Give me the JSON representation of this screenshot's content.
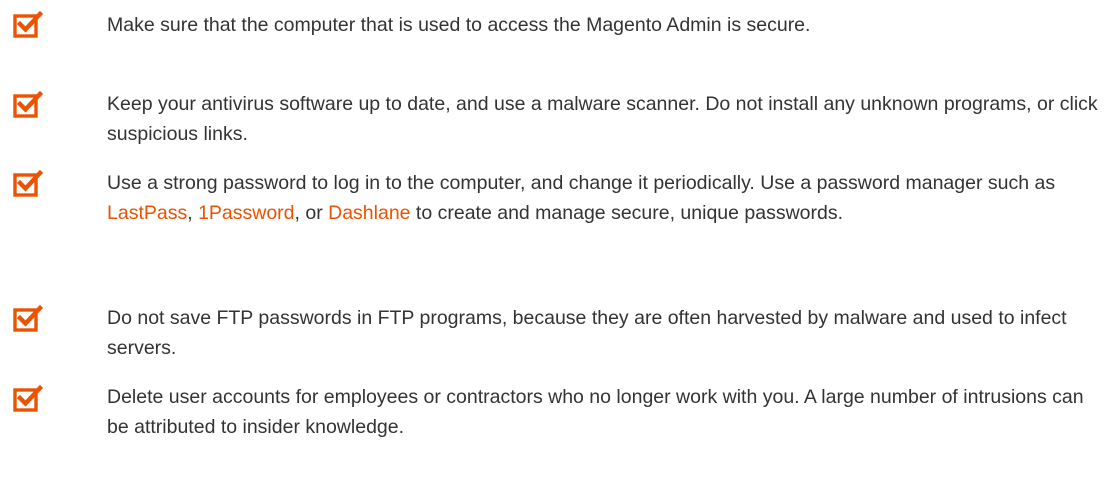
{
  "accent_color": "#eb5202",
  "icon_name": "checkbox-checked-icon",
  "items": [
    {
      "text": "Make sure that the computer that is used to access the Magento Admin is secure."
    },
    {
      "text": "Keep your antivirus software up to date, and use a malware scanner. Do not install any unknown programs, or click suspicious links."
    },
    {
      "text_1": "Use a strong password to log in to the computer, and change it periodically. Use a password manager such as ",
      "link_1": "LastPass",
      "sep_1": ", ",
      "link_2": "1Password",
      "sep_2": ", or ",
      "link_3": "Dashlane",
      "text_2": " to create and manage secure, unique passwords."
    },
    {
      "text": "Do not save FTP passwords in FTP programs, because they are often harvested by malware and used to infect servers."
    },
    {
      "text": "Delete user accounts for employees or contractors who no longer work with you. A large number of intrusions can be attributed to insider knowledge."
    }
  ]
}
